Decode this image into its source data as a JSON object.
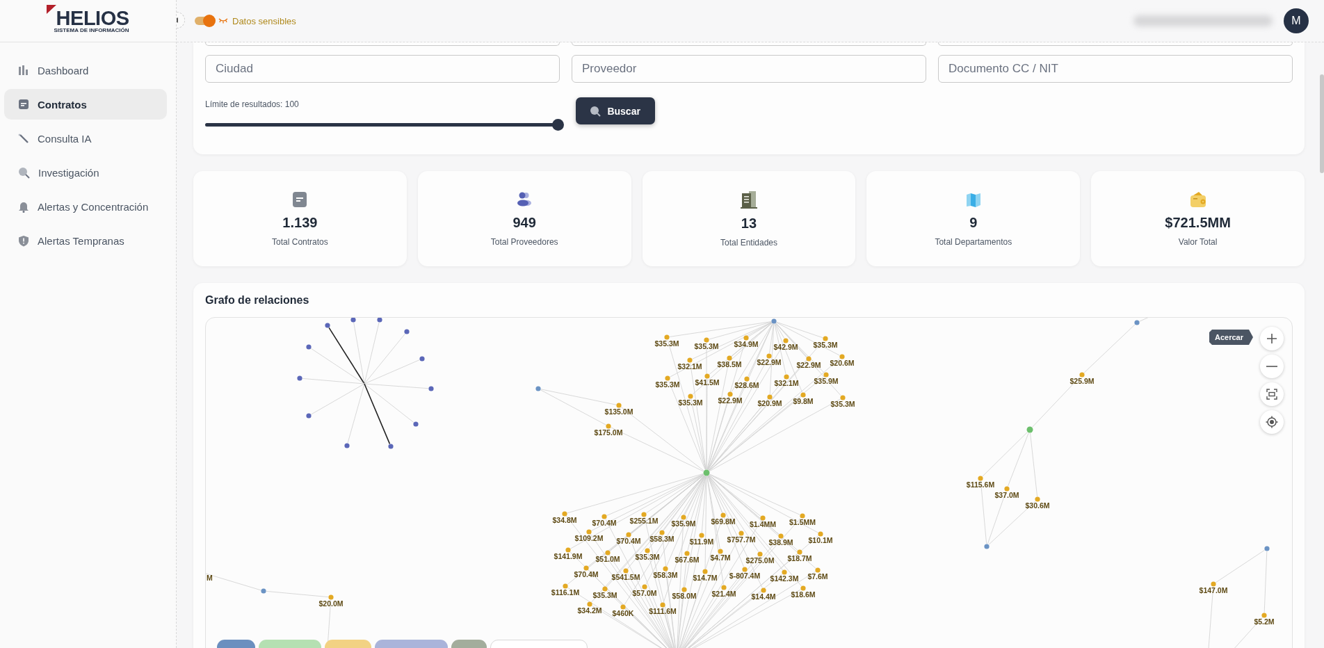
{
  "logo": {
    "name": "HELIOS",
    "subtitle": "SISTEMA DE INFORMACIÓN"
  },
  "sidebar": {
    "items": [
      {
        "label": "Dashboard",
        "kind": "chart",
        "selected": false
      },
      {
        "label": "Contratos",
        "kind": "document",
        "selected": true
      },
      {
        "label": "Consulta IA",
        "kind": "wand",
        "selected": false
      },
      {
        "label": "Investigación",
        "kind": "search",
        "selected": false
      },
      {
        "label": "Alertas y Concentración",
        "kind": "bell",
        "selected": false
      },
      {
        "label": "Alertas Tempranas",
        "kind": "shield",
        "selected": false
      }
    ]
  },
  "topbar": {
    "sensitive_toggle": {
      "label": "Datos sensibles",
      "on": true
    },
    "avatar": "M"
  },
  "filters": {
    "fields": [
      {
        "placeholder": "Ciudad"
      },
      {
        "placeholder": "Proveedor"
      },
      {
        "placeholder": "Documento CC / NIT"
      }
    ],
    "limit": {
      "label": "Límite de resultados: 100",
      "level": 1
    },
    "search_button": "Buscar"
  },
  "stats": [
    {
      "kind": "contracts",
      "value": "1.139",
      "label": "Total Contratos"
    },
    {
      "kind": "providers",
      "value": "949",
      "label": "Total Proveedores"
    },
    {
      "kind": "entities",
      "value": "13",
      "label": "Total Entidades"
    },
    {
      "kind": "departments",
      "value": "9",
      "label": "Total Departamentos"
    },
    {
      "kind": "value",
      "value": "$721.5MM",
      "label": "Valor Total"
    }
  ],
  "graph": {
    "title": "Grafo de relaciones",
    "tooltip": "Acercar",
    "controls": [
      {
        "kind": "zoom_in"
      },
      {
        "kind": "zoom_out"
      },
      {
        "kind": "fit"
      },
      {
        "kind": "center"
      }
    ],
    "legend": [
      {
        "color": "#6b8fbf"
      },
      {
        "color": "#b5e0b2"
      },
      {
        "color": "#f2d283"
      },
      {
        "color": "#aab4da"
      },
      {
        "color": "#a3ad9c"
      },
      {
        "color": "#ffffff"
      }
    ],
    "nodes": [
      {
        "kind": "person"
      },
      {
        "kind": "person"
      },
      {
        "kind": "person"
      },
      {
        "kind": "person"
      },
      {
        "kind": "person"
      },
      {
        "kind": "person"
      },
      {
        "kind": "person"
      },
      {
        "kind": "person"
      },
      {
        "kind": "person"
      },
      {
        "kind": "person"
      },
      {
        "kind": "person"
      },
      {
        "kind": "person"
      },
      {
        "kind": "provider"
      },
      {
        "kind": "contract",
        "label": "$35.3M"
      },
      {
        "kind": "contract",
        "label": "$35.3M"
      },
      {
        "kind": "contract",
        "label": "$34.9M"
      },
      {
        "kind": "contract",
        "label": "$42.9M"
      },
      {
        "kind": "contract",
        "label": "$35.3M"
      },
      {
        "kind": "contract",
        "label": "$32.1M"
      },
      {
        "kind": "contract",
        "label": "$38.5M"
      },
      {
        "kind": "contract",
        "label": "$22.9M"
      },
      {
        "kind": "contract",
        "label": "$22.9M"
      },
      {
        "kind": "contract",
        "label": "$20.6M"
      },
      {
        "kind": "contract",
        "label": "$35.3M"
      },
      {
        "kind": "contract",
        "label": "$41.5M"
      },
      {
        "kind": "contract",
        "label": "$28.6M"
      },
      {
        "kind": "contract",
        "label": "$32.1M"
      },
      {
        "kind": "contract",
        "label": "$35.9M"
      },
      {
        "kind": "contract",
        "label": "$35.3M"
      },
      {
        "kind": "contract",
        "label": "$22.9M"
      },
      {
        "kind": "contract",
        "label": "$20.9M"
      },
      {
        "kind": "contract",
        "label": "$9.8M"
      },
      {
        "kind": "contract",
        "label": "$35.3M"
      },
      {
        "kind": "provider"
      },
      {
        "kind": "contract",
        "label": "$135.0M"
      },
      {
        "kind": "contract",
        "label": "$175.0M"
      },
      {
        "kind": "entity"
      },
      {
        "kind": "contract",
        "label": "$34.8M"
      },
      {
        "kind": "contract",
        "label": "$70.4M"
      },
      {
        "kind": "contract",
        "label": "$255.1M"
      },
      {
        "kind": "contract",
        "label": "$35.9M"
      },
      {
        "kind": "contract",
        "label": "$69.8M"
      },
      {
        "kind": "contract",
        "label": "$1.4MM"
      },
      {
        "kind": "contract",
        "label": "$1.5MM"
      },
      {
        "kind": "contract",
        "label": "$109.2M"
      },
      {
        "kind": "contract",
        "label": "$70.4M"
      },
      {
        "kind": "contract",
        "label": "$58.3M"
      },
      {
        "kind": "contract",
        "label": "$11.9M"
      },
      {
        "kind": "contract",
        "label": "$757.7M"
      },
      {
        "kind": "contract",
        "label": "$38.9M"
      },
      {
        "kind": "contract",
        "label": "$10.1M"
      },
      {
        "kind": "contract",
        "label": "$141.9M"
      },
      {
        "kind": "contract",
        "label": "$51.0M"
      },
      {
        "kind": "contract",
        "label": "$35.3M"
      },
      {
        "kind": "contract",
        "label": "$67.6M"
      },
      {
        "kind": "contract",
        "label": "$4.7M"
      },
      {
        "kind": "contract",
        "label": "$275.0M"
      },
      {
        "kind": "contract",
        "label": "$18.7M"
      },
      {
        "kind": "contract",
        "label": "$70.4M"
      },
      {
        "kind": "contract",
        "label": "$541.5M"
      },
      {
        "kind": "contract",
        "label": "$58.3M"
      },
      {
        "kind": "contract",
        "label": "$14.7M"
      },
      {
        "kind": "contract",
        "label": "$-807.4M"
      },
      {
        "kind": "contract",
        "label": "$142.3M"
      },
      {
        "kind": "contract",
        "label": "$7.6M"
      },
      {
        "kind": "contract",
        "label": "$116.1M"
      },
      {
        "kind": "contract",
        "label": "$35.3M"
      },
      {
        "kind": "contract",
        "label": "$57.0M"
      },
      {
        "kind": "contract",
        "label": "$58.0M"
      },
      {
        "kind": "contract",
        "label": "$21.4M"
      },
      {
        "kind": "contract",
        "label": "$14.4M"
      },
      {
        "kind": "contract",
        "label": "$18.6M"
      },
      {
        "kind": "contract",
        "label": "$34.2M"
      },
      {
        "kind": "contract",
        "label": "$460K"
      },
      {
        "kind": "contract",
        "label": "$111.6M"
      },
      {
        "kind": "provider"
      },
      {
        "kind": "cut",
        "label": "M"
      },
      {
        "kind": "contract",
        "label": "$20.0M"
      },
      {
        "kind": "provider"
      },
      {
        "kind": "contract",
        "label": "$25.9M"
      },
      {
        "kind": "entity"
      },
      {
        "kind": "contract",
        "label": "$115.6M"
      },
      {
        "kind": "contract",
        "label": "$37.0M"
      },
      {
        "kind": "contract",
        "label": "$30.6M"
      },
      {
        "kind": "provider"
      },
      {
        "kind": "provider"
      },
      {
        "kind": "contract",
        "label": "$147.0M"
      },
      {
        "kind": "contract",
        "label": "$5.2M"
      }
    ]
  }
}
